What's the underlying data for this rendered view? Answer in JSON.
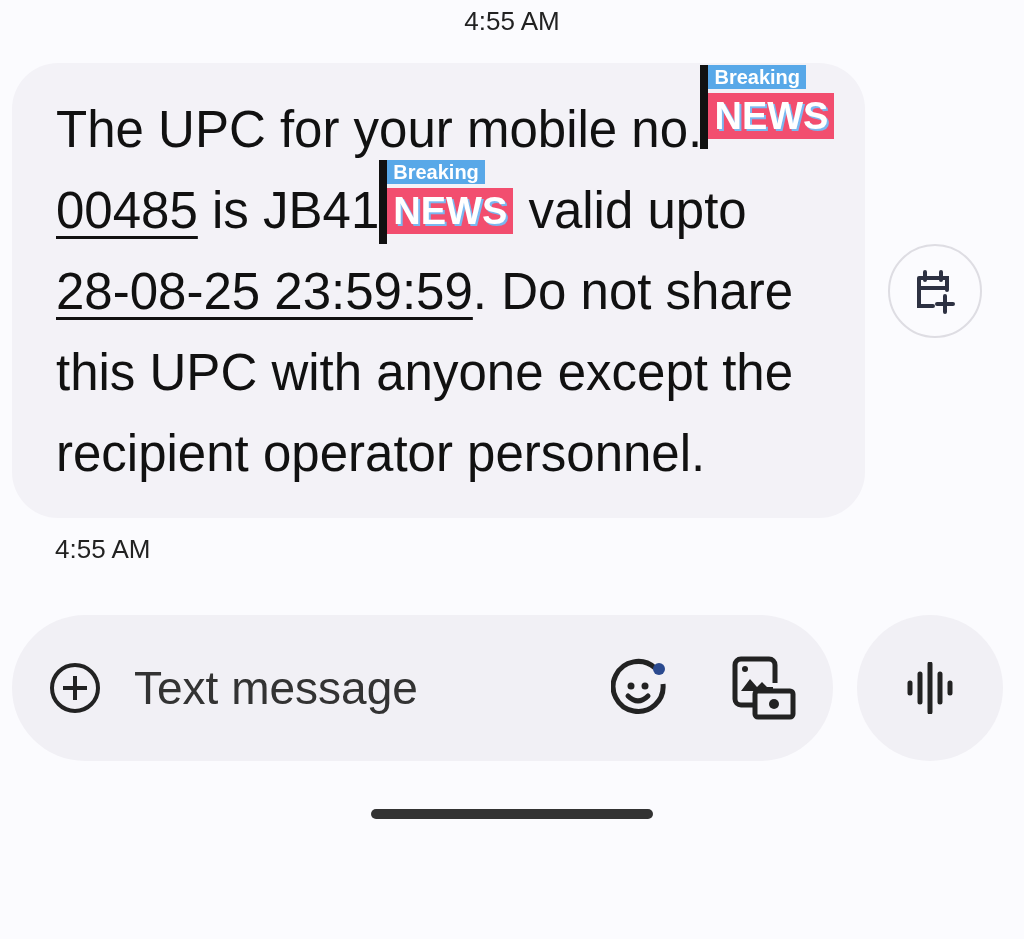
{
  "status_time": "4:55 AM",
  "message": {
    "intro": "The UPC for your mobile no.",
    "number_visible": "00485",
    "middle": " is JB41",
    "after_code": " valid upto ",
    "date": "28-08-25 23:59:59",
    "rest": ". Do not share this UPC with anyone except the recipient operator personnel.",
    "time": "4:55 AM"
  },
  "stickers": [
    {
      "top": "Breaking",
      "bottom": "NEWS"
    },
    {
      "top": "Breaking",
      "bottom": "NEWS"
    }
  ],
  "composer": {
    "placeholder": "Text message",
    "emoji_badge": true
  }
}
